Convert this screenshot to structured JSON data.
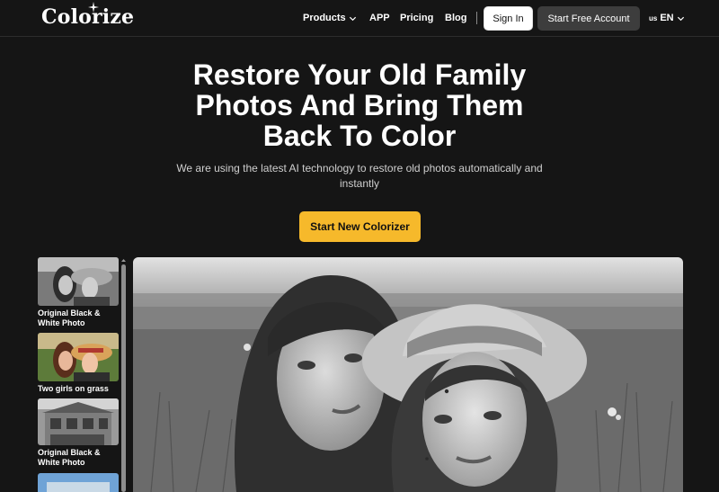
{
  "nav": {
    "logo": "Colorize",
    "links": [
      {
        "label": "Products",
        "has_dropdown": true
      },
      {
        "label": "APP"
      },
      {
        "label": "Pricing"
      },
      {
        "label": "Blog"
      }
    ],
    "sign_in": "Sign In",
    "start_account": "Start Free Account",
    "lang_flag": "us",
    "lang_code": "EN"
  },
  "hero": {
    "title_line1": "Restore Your Old Family",
    "title_line2": "Photos And Bring Them",
    "title_line3": "Back To Color",
    "subtitle_line1": "We are using the latest AI technology to restore old photos automatically and",
    "subtitle_line2": "instantly",
    "cta": "Start New Colorizer"
  },
  "thumbnails": [
    {
      "caption_line1": "Original Black &",
      "caption_line2": "White Photo"
    },
    {
      "caption_line1": "Two girls on grass",
      "caption_line2": ""
    },
    {
      "caption_line1": "Original Black &",
      "caption_line2": "White Photo"
    }
  ],
  "colors": {
    "background": "#151515",
    "accent": "#f6b92b",
    "secondary_button": "#3d3d3d"
  }
}
